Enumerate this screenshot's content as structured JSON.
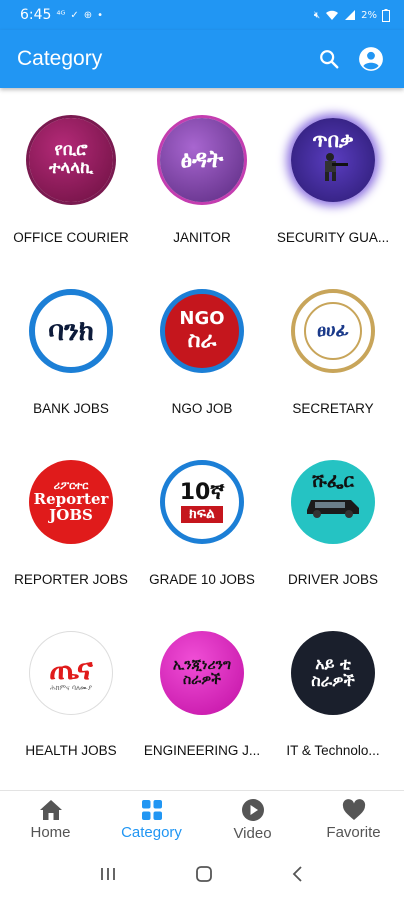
{
  "status_bar": {
    "time": "6:45",
    "notif_icons": [
      "lte-icon",
      "check-icon",
      "plus-icon",
      "dot-icon"
    ],
    "battery": "2%"
  },
  "app_bar": {
    "title": "Category",
    "actions": [
      "search-icon",
      "account-icon"
    ],
    "color": "#2196f3"
  },
  "categories": [
    {
      "label": "OFFICE COURIER",
      "icon_text": "የቢሮ ተላላኪ",
      "bg": "#8e1b5a"
    },
    {
      "label": "JANITOR",
      "icon_text": "ፅዳት",
      "bg": "#7b3fa0"
    },
    {
      "label": "SECURITY GUA...",
      "icon_text": "ጥበቃ",
      "bg": "#3a2a8a"
    },
    {
      "label": "BANK JOBS",
      "icon_text": "ባንክ",
      "bg": "#ffffff"
    },
    {
      "label": "NGO JOB",
      "icon_text_top": "NGO",
      "icon_text": "ስራ",
      "bg": "#c5161d"
    },
    {
      "label": "SECRETARY",
      "icon_text": "ፀሀፊ",
      "bg": "#ffffff"
    },
    {
      "label": "REPORTER JOBS",
      "icon_text_top": "ሪፖርተር",
      "icon_text": "Reporter JOBS",
      "bg": "#e01b1b"
    },
    {
      "label": "GRADE 10 JOBS",
      "icon_text": "10ኛ",
      "icon_text_bottom": "ክፍል",
      "bg": "#ffffff"
    },
    {
      "label": "DRIVER JOBS",
      "icon_text": "ሹፌር",
      "bg": "#25c3c3"
    },
    {
      "label": "HEALTH JOBS",
      "icon_text": "ጤና",
      "icon_text_bottom": "ሕክምና ባለሙያ",
      "bg": "#ffffff"
    },
    {
      "label": "ENGINEERING J...",
      "icon_text": "ኢንጂነሪንግ ስራዎች",
      "bg": "#e21fc1"
    },
    {
      "label": "IT & Technolo...",
      "icon_text": "አይ ቲ ስራዎች",
      "bg": "#1a1f2c"
    }
  ],
  "bottom_nav": [
    {
      "label": "Home",
      "icon": "home-icon",
      "active": false
    },
    {
      "label": "Category",
      "icon": "category-icon",
      "active": true
    },
    {
      "label": "Video",
      "icon": "play-icon",
      "active": false
    },
    {
      "label": "Favorite",
      "icon": "heart-icon",
      "active": false
    }
  ],
  "system_nav": [
    "recents-icon",
    "home-system-icon",
    "back-icon"
  ]
}
